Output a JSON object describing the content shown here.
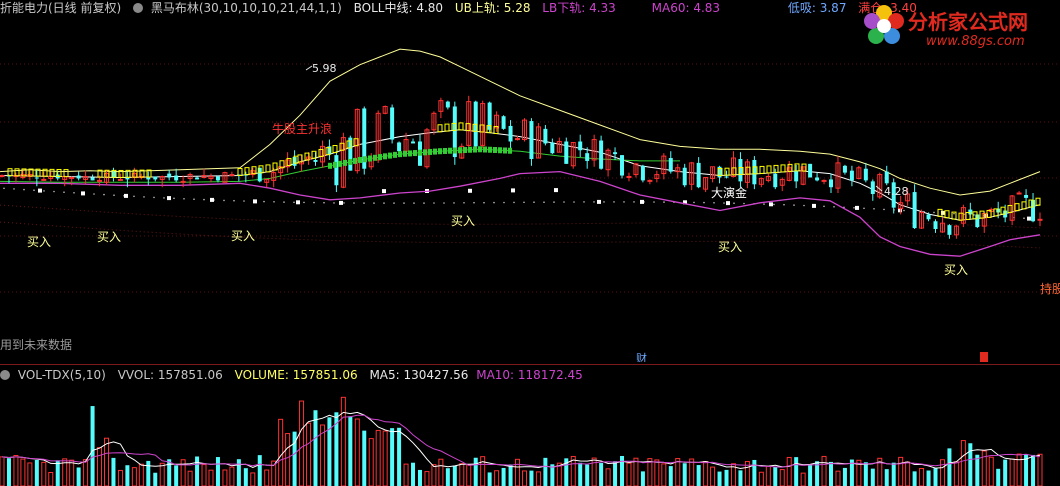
{
  "main_header": {
    "instrument": "折能电力(日线 前复权)",
    "indicator_name": "黑马布林(30,10,10,10,21,44,1,1)",
    "boll_mid_label": "BOLL中线: 4.80",
    "ub_label": "UB上轨: 5.28",
    "lb_label": "LB下轨: 4.33",
    "ma60_label": "MA60: 4.83",
    "low_buy_label": "低吸: 3.87",
    "full_pos_label": "满仓: 3.40"
  },
  "logo": {
    "name": "分析家公式网",
    "url": "www.88gs.com"
  },
  "annotations": {
    "high_label": "5.98",
    "low_label": "4.28",
    "bull_wave": "牛股主升浪",
    "big_gold": "大演金",
    "future_note": "用到未来数据",
    "hold": "持股",
    "cai": "财",
    "buy_labels": [
      "买入",
      "买入",
      "买入",
      "买入",
      "买入",
      "买入"
    ]
  },
  "volume_header": {
    "name": "VOL-TDX(5,10)",
    "vvol": "VVOL: 157851.06",
    "volume": "VOLUME: 157851.06",
    "ma5": "MA5: 130427.56",
    "ma10": "MA10: 118172.45"
  },
  "colors": {
    "up": "#ff3232",
    "down": "#54fcfc",
    "ub": "#ffff99",
    "lb": "#cc44cc",
    "mid": "#ffffff",
    "ma60_green": "#32cd32",
    "yellow_candle": "#ffff00",
    "ma5": "#ffffff",
    "ma10": "#cc44cc",
    "buy_text": "#ffff99",
    "sub_dots": "#ffffff"
  },
  "chart_data": [
    {
      "type": "candlestick",
      "ylim": [
        3.4,
        6.3
      ],
      "candles": [],
      "ub": [
        [
          0,
          4.72
        ],
        [
          30,
          4.74
        ],
        [
          60,
          4.72
        ],
        [
          90,
          4.73
        ],
        [
          120,
          4.72
        ],
        [
          150,
          4.73
        ],
        [
          180,
          4.74
        ],
        [
          210,
          4.75
        ],
        [
          240,
          4.76
        ],
        [
          270,
          5.0
        ],
        [
          300,
          5.3
        ],
        [
          330,
          5.65
        ],
        [
          360,
          5.82
        ],
        [
          380,
          5.9
        ],
        [
          400,
          5.98
        ],
        [
          420,
          5.96
        ],
        [
          440,
          5.9
        ],
        [
          460,
          5.8
        ],
        [
          490,
          5.65
        ],
        [
          520,
          5.5
        ],
        [
          560,
          5.35
        ],
        [
          600,
          5.2
        ],
        [
          640,
          5.05
        ],
        [
          680,
          4.98
        ],
        [
          720,
          4.95
        ],
        [
          760,
          4.95
        ],
        [
          800,
          4.93
        ],
        [
          830,
          4.9
        ],
        [
          860,
          4.82
        ],
        [
          880,
          4.75
        ],
        [
          900,
          4.65
        ],
        [
          930,
          4.55
        ],
        [
          960,
          4.48
        ],
        [
          990,
          4.52
        ],
        [
          1010,
          4.6
        ],
        [
          1040,
          4.72
        ]
      ],
      "lb": [
        [
          0,
          4.6
        ],
        [
          60,
          4.6
        ],
        [
          120,
          4.58
        ],
        [
          180,
          4.58
        ],
        [
          240,
          4.6
        ],
        [
          270,
          4.55
        ],
        [
          300,
          4.48
        ],
        [
          330,
          4.43
        ],
        [
          360,
          4.45
        ],
        [
          400,
          4.5
        ],
        [
          430,
          4.52
        ],
        [
          460,
          4.57
        ],
        [
          500,
          4.65
        ],
        [
          520,
          4.7
        ],
        [
          560,
          4.72
        ],
        [
          600,
          4.62
        ],
        [
          640,
          4.48
        ],
        [
          680,
          4.4
        ],
        [
          720,
          4.32
        ],
        [
          760,
          4.4
        ],
        [
          800,
          4.45
        ],
        [
          830,
          4.42
        ],
        [
          860,
          4.25
        ],
        [
          880,
          4.05
        ],
        [
          900,
          3.95
        ],
        [
          930,
          3.87
        ],
        [
          960,
          3.85
        ],
        [
          990,
          3.95
        ],
        [
          1010,
          4.02
        ],
        [
          1040,
          4.07
        ]
      ],
      "mid": [
        [
          0,
          4.68
        ],
        [
          60,
          4.67
        ],
        [
          120,
          4.66
        ],
        [
          180,
          4.67
        ],
        [
          240,
          4.68
        ],
        [
          270,
          4.72
        ],
        [
          300,
          4.82
        ],
        [
          330,
          4.9
        ],
        [
          360,
          5.0
        ],
        [
          400,
          5.08
        ],
        [
          430,
          5.12
        ],
        [
          460,
          5.15
        ],
        [
          490,
          5.12
        ],
        [
          520,
          5.08
        ],
        [
          560,
          5.0
        ],
        [
          600,
          4.92
        ],
        [
          640,
          4.78
        ],
        [
          680,
          4.72
        ],
        [
          720,
          4.68
        ],
        [
          760,
          4.7
        ],
        [
          800,
          4.73
        ],
        [
          830,
          4.7
        ],
        [
          860,
          4.6
        ],
        [
          880,
          4.5
        ],
        [
          900,
          4.38
        ],
        [
          930,
          4.28
        ],
        [
          960,
          4.22
        ],
        [
          990,
          4.25
        ],
        [
          1010,
          4.3
        ],
        [
          1040,
          4.38
        ]
      ],
      "ma60": [
        [
          0,
          4.62
        ],
        [
          60,
          4.61
        ],
        [
          120,
          4.61
        ],
        [
          180,
          4.61
        ],
        [
          240,
          4.62
        ],
        [
          270,
          4.65
        ],
        [
          300,
          4.72
        ],
        [
          330,
          4.78
        ],
        [
          360,
          4.84
        ],
        [
          400,
          4.9
        ],
        [
          440,
          4.93
        ],
        [
          480,
          4.95
        ],
        [
          520,
          4.93
        ],
        [
          560,
          4.88
        ],
        [
          600,
          4.85
        ],
        [
          640,
          4.83
        ],
        [
          680,
          4.83
        ]
      ],
      "high": 5.98,
      "low": 4.28
    },
    {
      "type": "bar",
      "title": "VOL-TDX(5,10)",
      "ylim": [
        0,
        320000
      ],
      "volumes": [],
      "ma5": [],
      "ma10": []
    }
  ]
}
